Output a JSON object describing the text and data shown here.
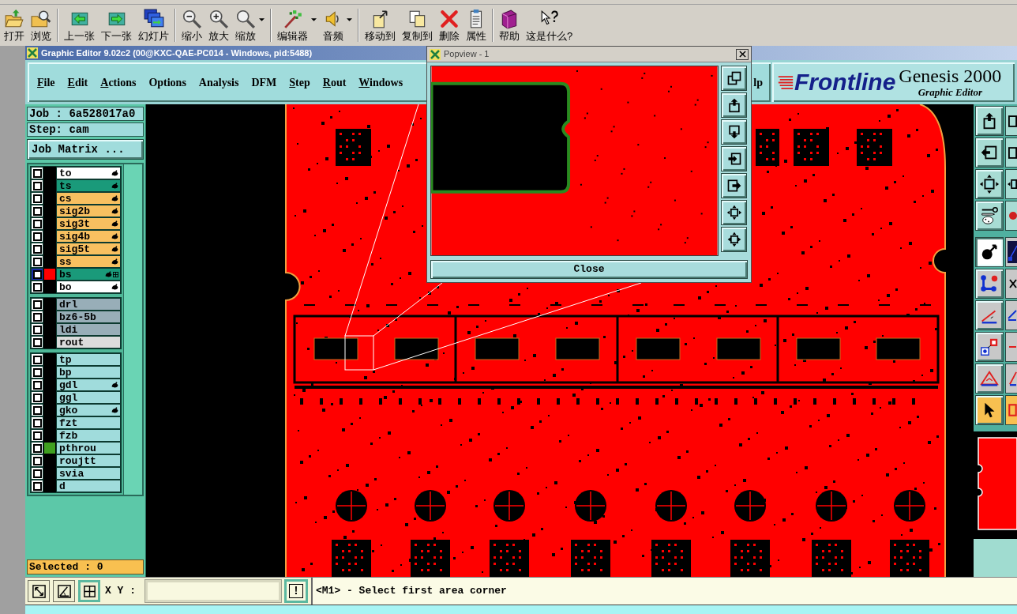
{
  "toolbar": {
    "groups": [
      {
        "buttons": [
          {
            "label": "打开",
            "menu": false
          },
          {
            "label": "浏览",
            "menu": false
          }
        ]
      },
      {
        "buttons": [
          {
            "label": "上一张",
            "menu": false
          },
          {
            "label": "下一张",
            "menu": false
          },
          {
            "label": "幻灯片",
            "menu": false
          }
        ]
      },
      {
        "buttons": [
          {
            "label": "缩小",
            "menu": false
          },
          {
            "label": "放大",
            "menu": false
          },
          {
            "label": "缩放",
            "menu": true
          }
        ]
      },
      {
        "buttons": [
          {
            "label": "编辑器",
            "menu": true
          },
          {
            "label": "音频",
            "menu": true
          }
        ]
      },
      {
        "buttons": [
          {
            "label": "移动到",
            "menu": false
          },
          {
            "label": "复制到",
            "menu": false
          },
          {
            "label": "删除",
            "menu": false
          },
          {
            "label": "属性",
            "menu": false
          }
        ]
      },
      {
        "buttons": [
          {
            "label": "帮助",
            "menu": false
          },
          {
            "label": "这是什么?",
            "menu": false
          }
        ]
      }
    ]
  },
  "window": {
    "title": "Graphic Editor 9.02c2 (00@KXC-QAE-PC014 - Windows, pid:5488)"
  },
  "menu": [
    {
      "label": "File",
      "underlined": true
    },
    {
      "label": "Edit",
      "underlined": true
    },
    {
      "label": "Actions",
      "underlined": true
    },
    {
      "label": "Options",
      "underlined": false
    },
    {
      "label": "Analysis",
      "underlined": false
    },
    {
      "label": "DFM",
      "underlined": false
    },
    {
      "label": "Step",
      "underlined": true
    },
    {
      "label": "Rout",
      "underlined": true
    },
    {
      "label": "Windows",
      "underlined": true
    }
  ],
  "menu_tail": "lp",
  "logo": {
    "brand": "Frontline",
    "product": "Genesis 2000",
    "subtitle": "Graphic Editor"
  },
  "job": {
    "job": "Job : 6a528017a0",
    "step": "Step: cam",
    "matrix_button": "Job Matrix ..."
  },
  "layer_groups": [
    {
      "layers": [
        {
          "name": "to",
          "color": "#ffffff",
          "selected": false,
          "hand": true,
          "grid": false
        },
        {
          "name": "ts",
          "color": "#1a9a7a",
          "selected": false,
          "hand": true,
          "grid": false
        },
        {
          "name": "cs",
          "color": "#f8c060",
          "selected": false,
          "hand": true,
          "grid": false
        },
        {
          "name": "sig2b",
          "color": "#f8c060",
          "selected": false,
          "hand": true,
          "grid": false
        },
        {
          "name": "sig3t",
          "color": "#f8c060",
          "selected": false,
          "hand": true,
          "grid": false
        },
        {
          "name": "sig4b",
          "color": "#f8c060",
          "selected": false,
          "hand": true,
          "grid": false
        },
        {
          "name": "sig5t",
          "color": "#f8c060",
          "selected": false,
          "hand": true,
          "grid": false
        },
        {
          "name": "ss",
          "color": "#f8c060",
          "selected": false,
          "hand": true,
          "grid": false
        },
        {
          "name": "bs",
          "color": "#1a9a7a",
          "selected": true,
          "hand": true,
          "grid": true,
          "swatch": {
            "color": "#ff0000"
          }
        },
        {
          "name": "bo",
          "color": "#ffffff",
          "selected": false,
          "hand": true,
          "grid": false
        }
      ]
    },
    {
      "layers": [
        {
          "name": "drl",
          "color": "#98aeb8",
          "selected": false,
          "hand": false,
          "grid": false
        },
        {
          "name": "bz6-5b",
          "color": "#98aeb8",
          "selected": false,
          "hand": false,
          "grid": false
        },
        {
          "name": "ldi",
          "color": "#98aeb8",
          "selected": false,
          "hand": false,
          "grid": false
        },
        {
          "name": "rout",
          "color": "#dcdcdc",
          "selected": false,
          "hand": false,
          "grid": false
        }
      ]
    },
    {
      "layers": [
        {
          "name": "tp",
          "color": "#a0dcdc",
          "selected": false,
          "hand": false,
          "grid": false
        },
        {
          "name": "bp",
          "color": "#a0dcdc",
          "selected": false,
          "hand": false,
          "grid": false
        },
        {
          "name": "gdl",
          "color": "#a0dcdc",
          "selected": false,
          "hand": true,
          "grid": false
        },
        {
          "name": "ggl",
          "color": "#a0dcdc",
          "selected": false,
          "hand": false,
          "grid": false
        },
        {
          "name": "gko",
          "color": "#a0dcdc",
          "selected": false,
          "hand": true,
          "grid": false
        },
        {
          "name": "fzt",
          "color": "#a0dcdc",
          "selected": false,
          "hand": false,
          "grid": false
        },
        {
          "name": "fzb",
          "color": "#a0dcdc",
          "selected": false,
          "hand": false,
          "grid": false
        },
        {
          "name": "pthrou",
          "color": "#a0dcdc",
          "selected": false,
          "hand": false,
          "grid": false,
          "swatch": {
            "color": "#40a020"
          }
        },
        {
          "name": "roujtt",
          "color": "#a0dcdc",
          "selected": false,
          "hand": false,
          "grid": false
        },
        {
          "name": "svia",
          "color": "#a0dcdc",
          "selected": false,
          "hand": false,
          "grid": false
        },
        {
          "name": "d",
          "color": "#a0dcdc",
          "selected": false,
          "hand": false,
          "grid": false
        }
      ]
    }
  ],
  "selected_count": "Selected : 0",
  "tools": [
    {
      "pressed": false,
      "on": false
    },
    {
      "pressed": false,
      "on": false
    },
    {
      "pressed": false,
      "on": false
    },
    {
      "pressed": false,
      "on": false
    },
    {
      "pressed": false,
      "on": false
    },
    {
      "pressed": false,
      "on": false
    },
    {
      "pressed": false,
      "on": false
    },
    {
      "pressed": false,
      "on": false
    },
    {
      "pressed": true,
      "on": false
    },
    {
      "pressed": false,
      "on": false
    },
    {
      "pressed": false,
      "on": false
    },
    {
      "pressed": false,
      "on": false
    },
    {
      "pressed": false,
      "on": false
    },
    {
      "pressed": false,
      "on": false
    },
    {
      "pressed": false,
      "on": false
    },
    {
      "pressed": false,
      "on": false
    },
    {
      "pressed": false,
      "on": false
    },
    {
      "pressed": false,
      "on": false
    },
    {
      "pressed": false,
      "on": true
    },
    {
      "pressed": false,
      "on": true
    }
  ],
  "command_bar": {
    "tools": [
      {
        "on": false
      },
      {
        "on": false
      },
      {
        "on": true
      }
    ],
    "coord_label": "X Y :",
    "alert_button": "!",
    "message": "<M1> - Select first area corner"
  },
  "popview": {
    "title": "Popview - 1",
    "close_button": "Close"
  }
}
